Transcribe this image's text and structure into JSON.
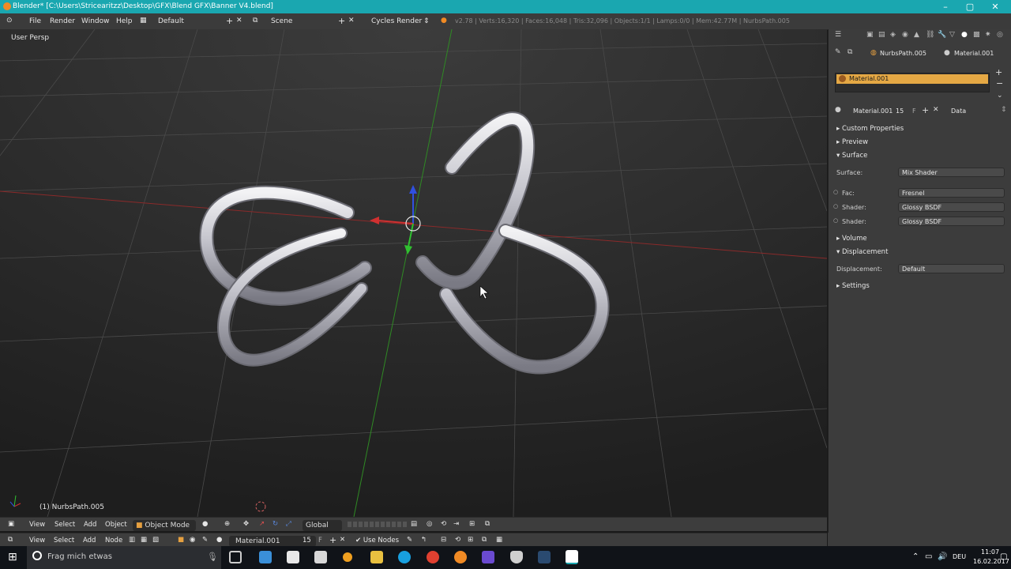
{
  "titlebar": {
    "title": "Blender* [C:\\Users\\Stricearitzz\\Desktop\\GFX\\Blend GFX\\Banner V4.blend]",
    "minimize": "–",
    "maximize": "▢",
    "close": "✕"
  },
  "menu": {
    "file": "File",
    "render": "Render",
    "window": "Window",
    "help": "Help",
    "layout": "Default",
    "scene": "Scene",
    "engine": "Cycles Render",
    "stats": "v2.78 | Verts:16,320 | Faces:16,048 | Tris:32,096 | Objects:1/1 | Lamps:0/0 | Mem:42.77M | NurbsPath.005"
  },
  "viewport": {
    "view_label": "User Persp",
    "object_label": "(1) NurbsPath.005"
  },
  "properties": {
    "breadcrumb_object": "NurbsPath.005",
    "breadcrumb_material": "Material.001",
    "material_slot": "Material.001",
    "material_name": "Material.001",
    "users": "15",
    "fake": "F",
    "link": "Data",
    "sections": {
      "custom_properties": "Custom Properties",
      "preview": "Preview",
      "surface": "Surface",
      "volume": "Volume",
      "displacement": "Displacement",
      "settings": "Settings"
    },
    "surface_label": "Surface:",
    "surface_value": "Mix Shader",
    "fac_label": "Fac:",
    "fac_value": "Fresnel",
    "shader1_label": "Shader:",
    "shader1_value": "Glossy BSDF",
    "shader2_label": "Shader:",
    "shader2_value": "Glossy BSDF",
    "displacement_label": "Displacement:",
    "displacement_value": "Default"
  },
  "view_footer": {
    "view": "View",
    "select": "Select",
    "add": "Add",
    "object": "Object",
    "mode": "Object Mode",
    "orientation": "Global"
  },
  "node_footer": {
    "view": "View",
    "select": "Select",
    "add": "Add",
    "node": "Node",
    "material": "Material.001",
    "users": "15",
    "fake": "F",
    "use_nodes": "Use Nodes"
  },
  "taskbar": {
    "search_placeholder": "Frag mich etwas",
    "language": "DEU",
    "time": "11:07",
    "date": "16.02.2017"
  },
  "colors": {
    "titlebar": "#1aa7b0",
    "selected_material": "#e5a844",
    "x_axis": "#b03030",
    "y_axis": "#3a9a2a"
  }
}
